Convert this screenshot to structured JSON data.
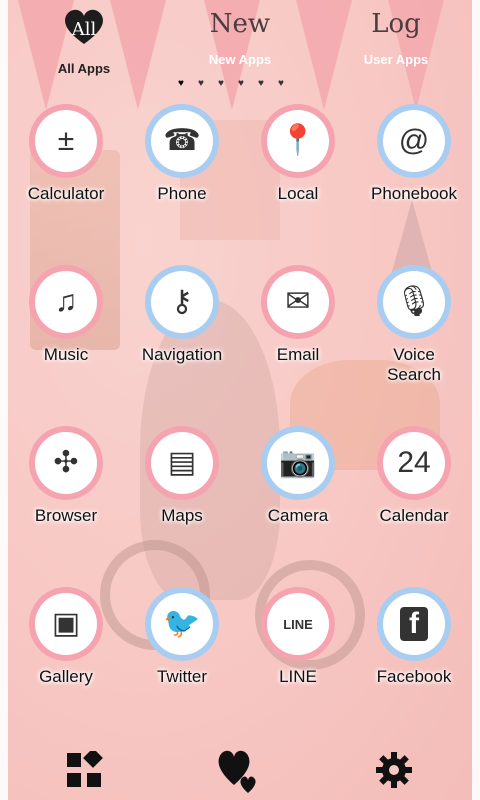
{
  "tabs": [
    {
      "glyph": "All",
      "label": "All Apps",
      "active": true
    },
    {
      "glyph": "New",
      "label": "New Apps",
      "active": false
    },
    {
      "glyph": "Log",
      "label": "User Apps",
      "active": false
    }
  ],
  "page_indicator": {
    "count": 6,
    "current": 1,
    "glyph": "♥"
  },
  "apps": [
    {
      "label": "Calculator",
      "icon": "calculator-icon",
      "sym": "±",
      "ring": "pink"
    },
    {
      "label": "Phone",
      "icon": "phone-icon",
      "sym": "☎",
      "ring": "blue"
    },
    {
      "label": "Local",
      "icon": "map-pin-icon",
      "sym": "📍",
      "ring": "pink"
    },
    {
      "label": "Phonebook",
      "icon": "phonebook-icon",
      "sym": "@",
      "ring": "blue"
    },
    {
      "label": "Music",
      "icon": "music-note-icon",
      "sym": "♫",
      "ring": "pink"
    },
    {
      "label": "Navigation",
      "icon": "key-icon",
      "sym": "⚷",
      "ring": "blue"
    },
    {
      "label": "Email",
      "icon": "envelope-icon",
      "sym": "✉",
      "ring": "pink"
    },
    {
      "label": "Voice\nSearch",
      "icon": "microphone-icon",
      "sym": "🎙",
      "ring": "blue"
    },
    {
      "label": "Browser",
      "icon": "compass-icon",
      "sym": "✣",
      "ring": "pink"
    },
    {
      "label": "Maps",
      "icon": "folded-map-icon",
      "sym": "▤",
      "ring": "pink"
    },
    {
      "label": "Camera",
      "icon": "camera-icon",
      "sym": "📷",
      "ring": "blue"
    },
    {
      "label": "Calendar",
      "icon": "calendar-icon",
      "sym": "24",
      "ring": "pink"
    },
    {
      "label": "Gallery",
      "icon": "picture-frame-icon",
      "sym": "▣",
      "ring": "pink"
    },
    {
      "label": "Twitter",
      "icon": "bird-icon",
      "sym": "🐦",
      "ring": "blue"
    },
    {
      "label": "LINE",
      "icon": "line-chat-icon",
      "sym": "LINE",
      "ring": "pink"
    },
    {
      "label": "Facebook",
      "icon": "facebook-icon",
      "sym": "f",
      "ring": "blue"
    }
  ],
  "dock": [
    {
      "icon": "apps-grid-icon",
      "sym": "▞"
    },
    {
      "icon": "hearts-icon",
      "sym": "♥"
    },
    {
      "icon": "gear-icon",
      "sym": "⚙"
    }
  ],
  "colors": {
    "background": "#f7c9c6",
    "pennant": "#f2a6ad",
    "ring_pink": "#f6a3b0",
    "ring_blue": "#a9cdf0"
  }
}
